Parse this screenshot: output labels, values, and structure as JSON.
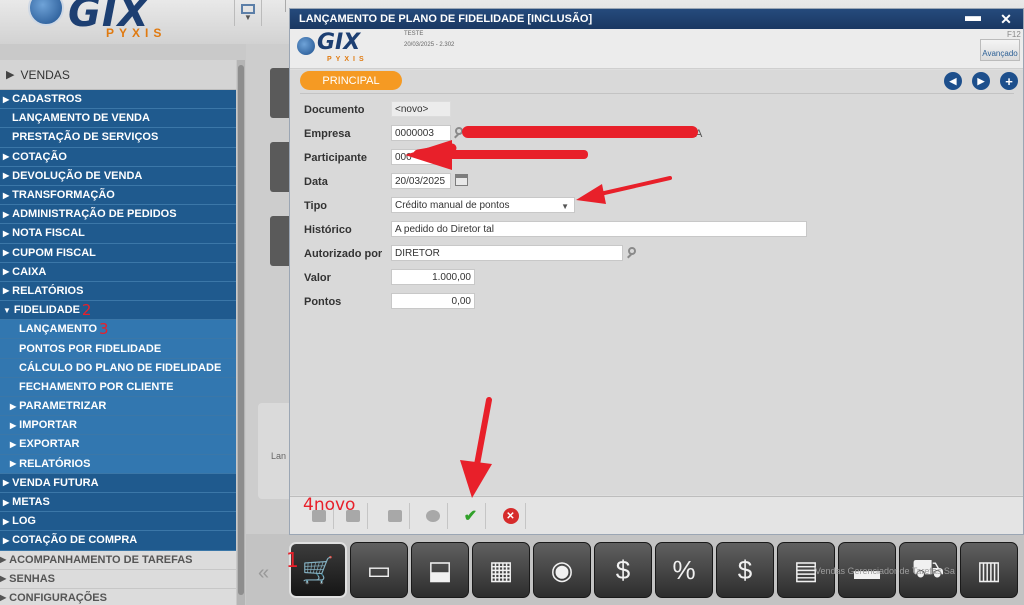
{
  "app": {
    "logo_text": "GIX",
    "logo_sub": "PYXIS"
  },
  "sidebar": {
    "header": "VENDAS",
    "items": [
      {
        "label": "CADASTROS",
        "style": "l0",
        "tri": "▶"
      },
      {
        "label": "LANÇAMENTO DE VENDA",
        "style": "l0p",
        "tri": ""
      },
      {
        "label": "PRESTAÇÃO DE SERVIÇOS",
        "style": "l0p",
        "tri": ""
      },
      {
        "label": "COTAÇÃO",
        "style": "l0",
        "tri": "▶"
      },
      {
        "label": "DEVOLUÇÃO DE VENDA",
        "style": "l0",
        "tri": "▶"
      },
      {
        "label": "TRANSFORMAÇÃO",
        "style": "l0",
        "tri": "▶"
      },
      {
        "label": "ADMINISTRAÇÃO DE PEDIDOS",
        "style": "l0",
        "tri": "▶"
      },
      {
        "label": "NOTA FISCAL",
        "style": "l0",
        "tri": "▶"
      },
      {
        "label": "CUPOM FISCAL",
        "style": "l0",
        "tri": "▶"
      },
      {
        "label": "CAIXA",
        "style": "l0",
        "tri": "▶"
      },
      {
        "label": "RELATÓRIOS",
        "style": "l0",
        "tri": "▶"
      },
      {
        "label": "FIDELIDADE",
        "style": "l0",
        "tri": "▼",
        "step": "2"
      },
      {
        "label": "LANÇAMENTO",
        "style": "l1",
        "tri": "",
        "step": "3"
      },
      {
        "label": "PONTOS POR FIDELIDADE",
        "style": "l1",
        "tri": ""
      },
      {
        "label": "CÁLCULO DO PLANO DE FIDELIDADE",
        "style": "l1",
        "tri": ""
      },
      {
        "label": "FECHAMENTO POR CLIENTE",
        "style": "l1",
        "tri": ""
      },
      {
        "label": "PARAMETRIZAR",
        "style": "l1a",
        "tri": "▶"
      },
      {
        "label": "IMPORTAR",
        "style": "l1a",
        "tri": "▶"
      },
      {
        "label": "EXPORTAR",
        "style": "l1a",
        "tri": "▶"
      },
      {
        "label": "RELATÓRIOS",
        "style": "l1a",
        "tri": "▶"
      },
      {
        "label": "VENDA FUTURA",
        "style": "l0",
        "tri": "▶"
      },
      {
        "label": "METAS",
        "style": "l0",
        "tri": "▶"
      },
      {
        "label": "LOG",
        "style": "l0",
        "tri": "▶"
      },
      {
        "label": "COTAÇÃO DE COMPRA",
        "style": "l0",
        "tri": "▶"
      },
      {
        "label": "ACOMPANHAMENTO DE TAREFAS",
        "style": "gray",
        "tri": "▶"
      },
      {
        "label": "SENHAS",
        "style": "gray",
        "tri": "▶"
      },
      {
        "label": "CONFIGURAÇÕES",
        "style": "gray",
        "tri": "▶"
      }
    ]
  },
  "background": {
    "ghost_label": "Lan"
  },
  "dock": {
    "step": "1",
    "faint_text": "Vendas  Gerenciador de Tarefas  Sa"
  },
  "modal": {
    "title": "LANÇAMENTO DE PLANO DE FIDELIDADE  [INCLUSÃO]",
    "header": {
      "user": "TESTE",
      "date": "20/03/2025 - 2.302",
      "shortcut": "F12",
      "advanced_label": "Avançado"
    },
    "tab": "PRINCIPAL",
    "fields": {
      "documento": {
        "label": "Documento",
        "value": "<novo>"
      },
      "empresa": {
        "label": "Empresa",
        "value": "0000003",
        "tail": "A"
      },
      "participante": {
        "label": "Participante",
        "value": "000"
      },
      "data": {
        "label": "Data",
        "value": "20/03/2025"
      },
      "tipo": {
        "label": "Tipo",
        "value": "Crédito manual de pontos"
      },
      "historico": {
        "label": "Histórico",
        "value": "A pedido do Diretor tal"
      },
      "autorizado": {
        "label": "Autorizado por",
        "value": "DIRETOR"
      },
      "valor": {
        "label": "Valor",
        "value": "1.000,00"
      },
      "pontos": {
        "label": "Pontos",
        "value": "0,00"
      }
    },
    "footer": {
      "step_label": "4novo"
    }
  },
  "colors": {
    "title_bar": "#1f4170",
    "sidebar_blue": "#1f5a8e",
    "tab_orange": "#f59a23",
    "annotation_red": "#e8202a"
  }
}
